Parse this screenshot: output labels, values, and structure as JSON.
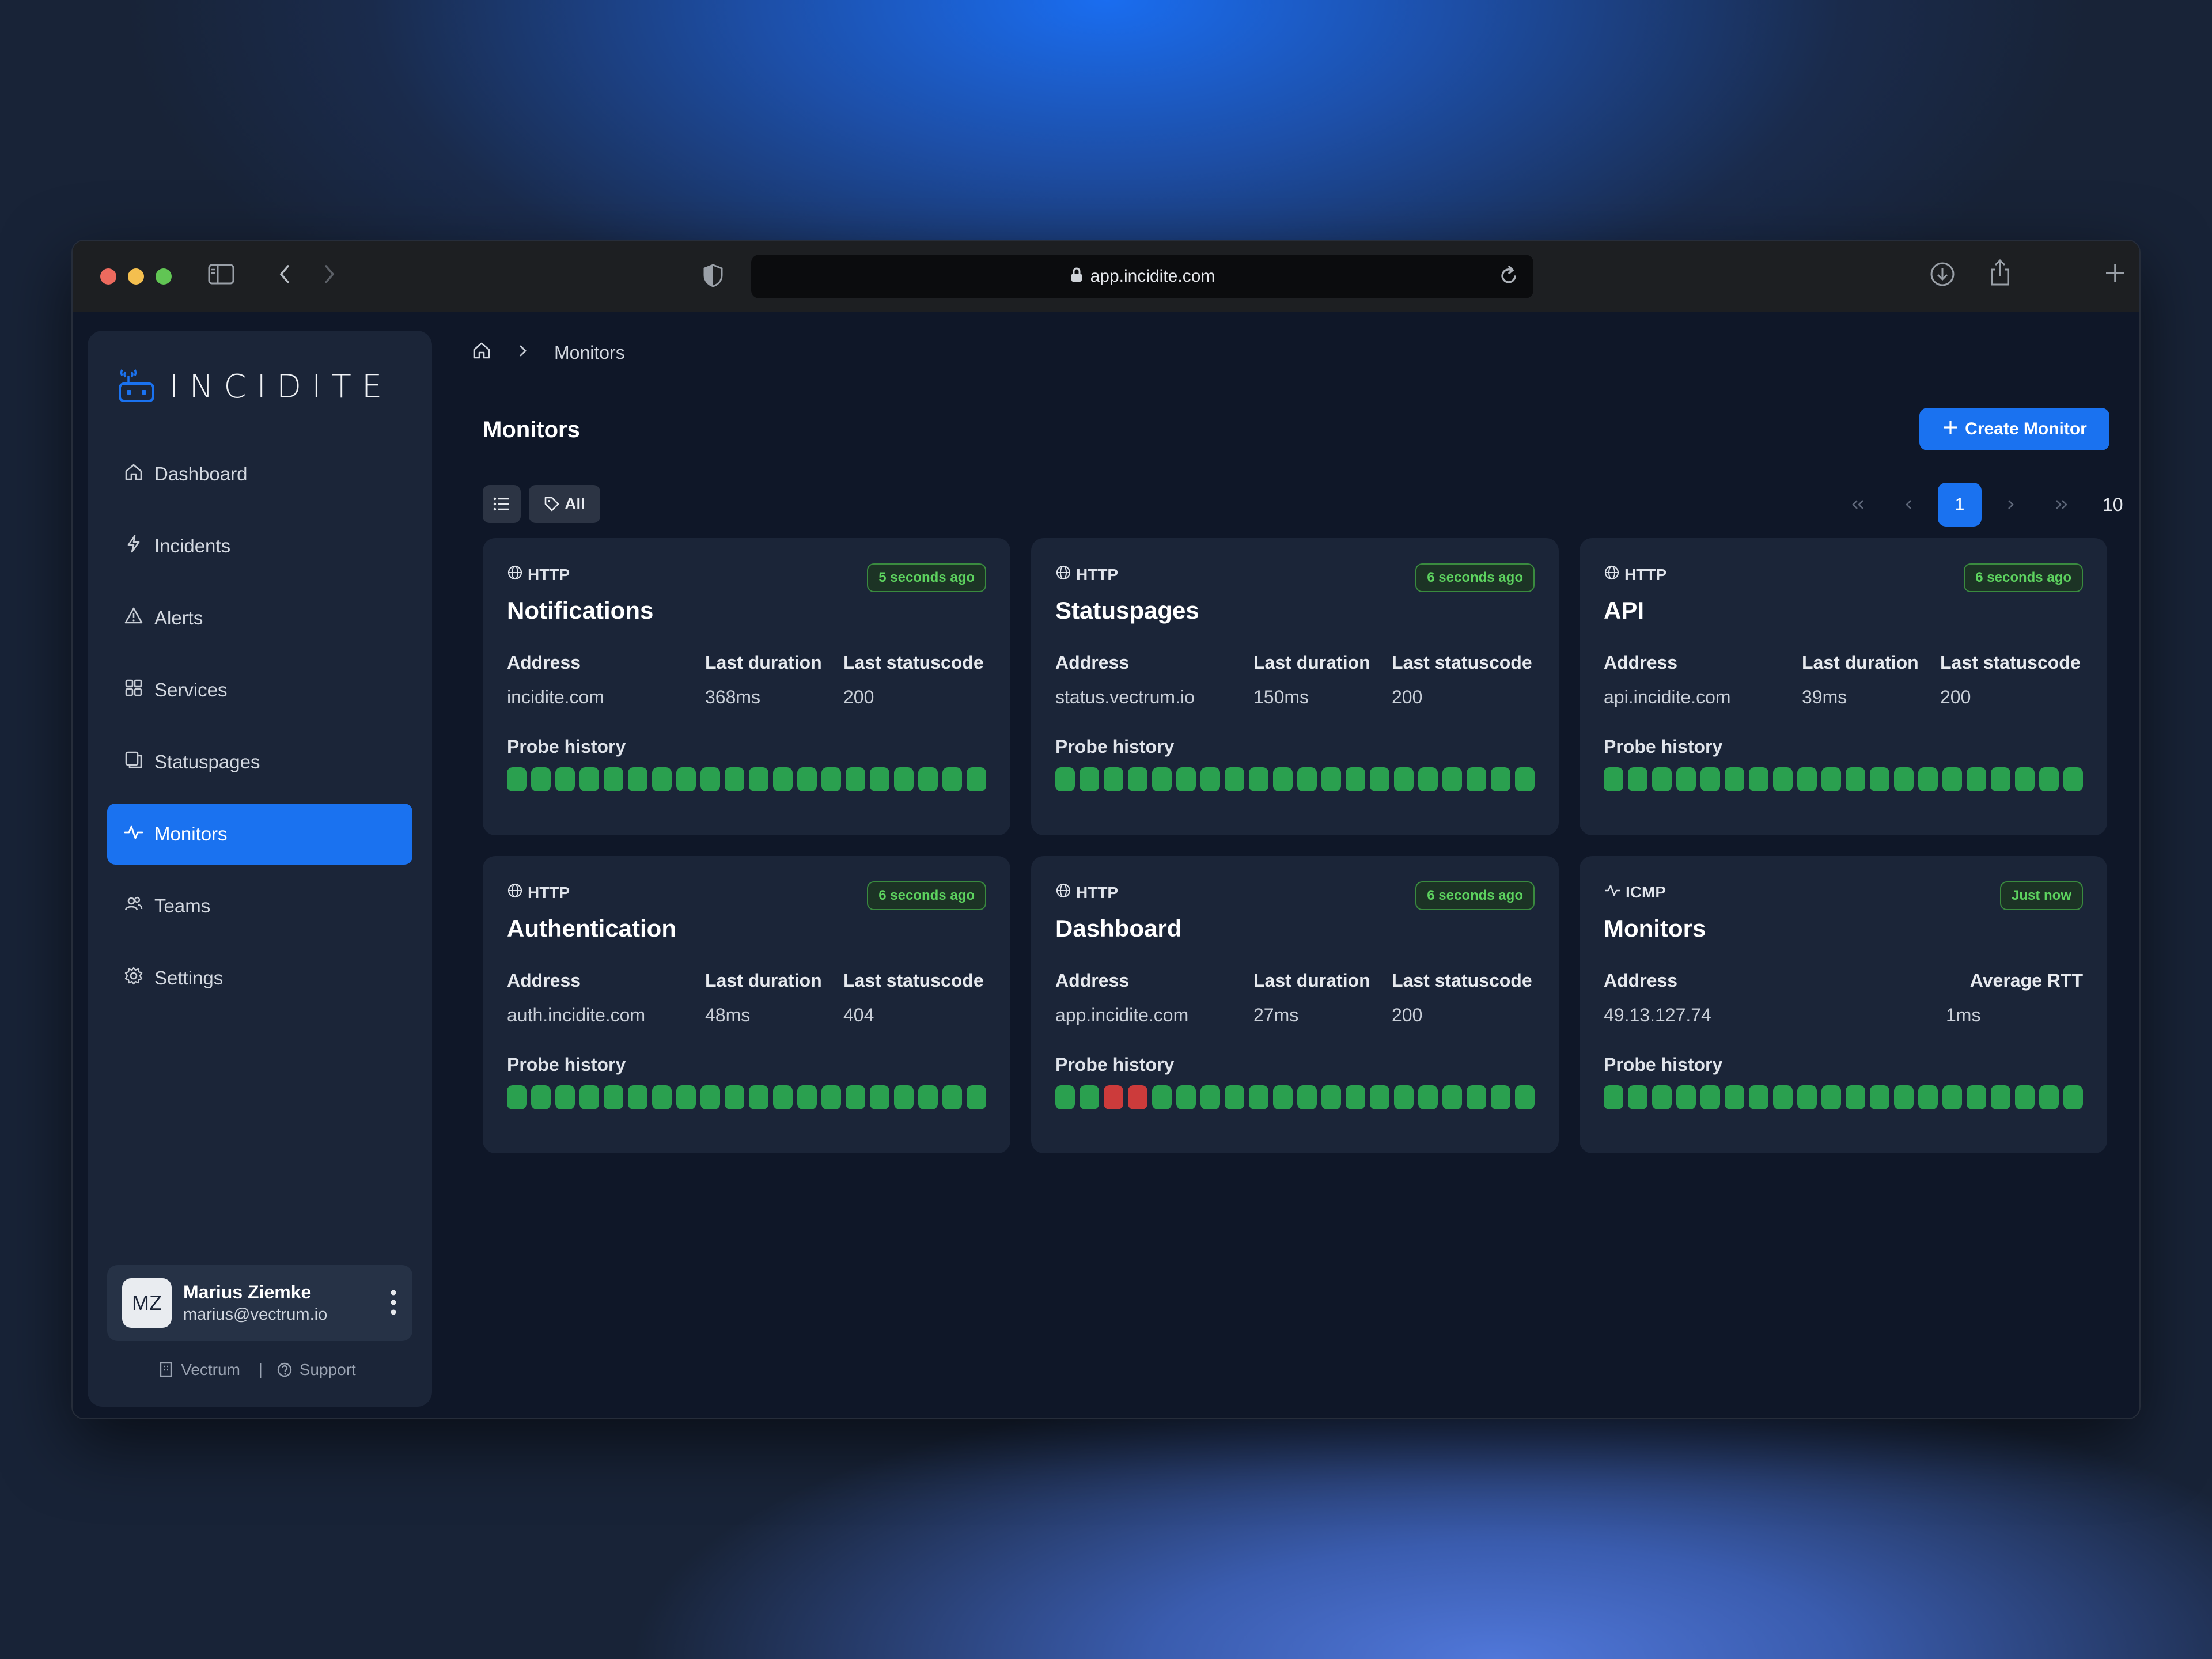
{
  "browser": {
    "url": "app.incidite.com"
  },
  "sidebar": {
    "logo_text": "INCIDITE",
    "items": [
      {
        "label": "Dashboard",
        "icon": "home-icon",
        "active": false
      },
      {
        "label": "Incidents",
        "icon": "bolt-icon",
        "active": false
      },
      {
        "label": "Alerts",
        "icon": "warning-icon",
        "active": false
      },
      {
        "label": "Services",
        "icon": "grid-icon",
        "active": false
      },
      {
        "label": "Statuspages",
        "icon": "pages-icon",
        "active": false
      },
      {
        "label": "Monitors",
        "icon": "pulse-icon",
        "active": true
      },
      {
        "label": "Teams",
        "icon": "users-icon",
        "active": false
      },
      {
        "label": "Settings",
        "icon": "gear-icon",
        "active": false
      }
    ],
    "user": {
      "initials": "MZ",
      "name": "Marius Ziemke",
      "email": "marius@vectrum.io"
    },
    "footer": {
      "org": "Vectrum",
      "separator": "|",
      "support": "Support"
    }
  },
  "breadcrumb": {
    "current": "Monitors"
  },
  "page": {
    "title": "Monitors",
    "create_label": "Create Monitor",
    "filter_all": "All"
  },
  "pagination": {
    "current_page": "1",
    "per_page": "10"
  },
  "colors": {
    "accent": "#1a72f0",
    "probe_ok": "#2aa04f",
    "probe_fail": "#cc3b3b",
    "badge_text": "#5dd35f"
  },
  "monitors": [
    {
      "type": "HTTP",
      "type_icon": "globe-icon",
      "name": "Notifications",
      "updated": "5 seconds ago",
      "col1_label": "Address",
      "col1_value": "incidite.com",
      "col2_label": "Last duration",
      "col2_value": "368ms",
      "col3_label": "Last statuscode",
      "col3_value": "200",
      "probe_label": "Probe history",
      "probes": [
        "ok",
        "ok",
        "ok",
        "ok",
        "ok",
        "ok",
        "ok",
        "ok",
        "ok",
        "ok",
        "ok",
        "ok",
        "ok",
        "ok",
        "ok",
        "ok",
        "ok",
        "ok",
        "ok",
        "ok"
      ]
    },
    {
      "type": "HTTP",
      "type_icon": "globe-icon",
      "name": "Statuspages",
      "updated": "6 seconds ago",
      "col1_label": "Address",
      "col1_value": "status.vectrum.io",
      "col2_label": "Last duration",
      "col2_value": "150ms",
      "col3_label": "Last statuscode",
      "col3_value": "200",
      "probe_label": "Probe history",
      "probes": [
        "ok",
        "ok",
        "ok",
        "ok",
        "ok",
        "ok",
        "ok",
        "ok",
        "ok",
        "ok",
        "ok",
        "ok",
        "ok",
        "ok",
        "ok",
        "ok",
        "ok",
        "ok",
        "ok",
        "ok"
      ]
    },
    {
      "type": "HTTP",
      "type_icon": "globe-icon",
      "name": "API",
      "updated": "6 seconds ago",
      "col1_label": "Address",
      "col1_value": "api.incidite.com",
      "col2_label": "Last duration",
      "col2_value": "39ms",
      "col3_label": "Last statuscode",
      "col3_value": "200",
      "probe_label": "Probe history",
      "probes": [
        "ok",
        "ok",
        "ok",
        "ok",
        "ok",
        "ok",
        "ok",
        "ok",
        "ok",
        "ok",
        "ok",
        "ok",
        "ok",
        "ok",
        "ok",
        "ok",
        "ok",
        "ok",
        "ok",
        "ok"
      ]
    },
    {
      "type": "HTTP",
      "type_icon": "globe-icon",
      "name": "Authentication",
      "updated": "6 seconds ago",
      "col1_label": "Address",
      "col1_value": "auth.incidite.com",
      "col2_label": "Last duration",
      "col2_value": "48ms",
      "col3_label": "Last statuscode",
      "col3_value": "404",
      "probe_label": "Probe history",
      "probes": [
        "ok",
        "ok",
        "ok",
        "ok",
        "ok",
        "ok",
        "ok",
        "ok",
        "ok",
        "ok",
        "ok",
        "ok",
        "ok",
        "ok",
        "ok",
        "ok",
        "ok",
        "ok",
        "ok",
        "ok"
      ]
    },
    {
      "type": "HTTP",
      "type_icon": "globe-icon",
      "name": "Dashboard",
      "updated": "6 seconds ago",
      "col1_label": "Address",
      "col1_value": "app.incidite.com",
      "col2_label": "Last duration",
      "col2_value": "27ms",
      "col3_label": "Last statuscode",
      "col3_value": "200",
      "probe_label": "Probe history",
      "probes": [
        "ok",
        "ok",
        "fail",
        "fail",
        "ok",
        "ok",
        "ok",
        "ok",
        "ok",
        "ok",
        "ok",
        "ok",
        "ok",
        "ok",
        "ok",
        "ok",
        "ok",
        "ok",
        "ok",
        "ok"
      ]
    },
    {
      "type": "ICMP",
      "type_icon": "pulse-icon",
      "name": "Monitors",
      "updated": "Just now",
      "col1_label": "Address",
      "col1_value": "49.13.127.74",
      "col2_label": "",
      "col2_value": "",
      "col3_label": "Average RTT",
      "col3_value": "1ms",
      "probe_label": "Probe history",
      "probes": [
        "ok",
        "ok",
        "ok",
        "ok",
        "ok",
        "ok",
        "ok",
        "ok",
        "ok",
        "ok",
        "ok",
        "ok",
        "ok",
        "ok",
        "ok",
        "ok",
        "ok",
        "ok",
        "ok",
        "ok"
      ]
    }
  ]
}
